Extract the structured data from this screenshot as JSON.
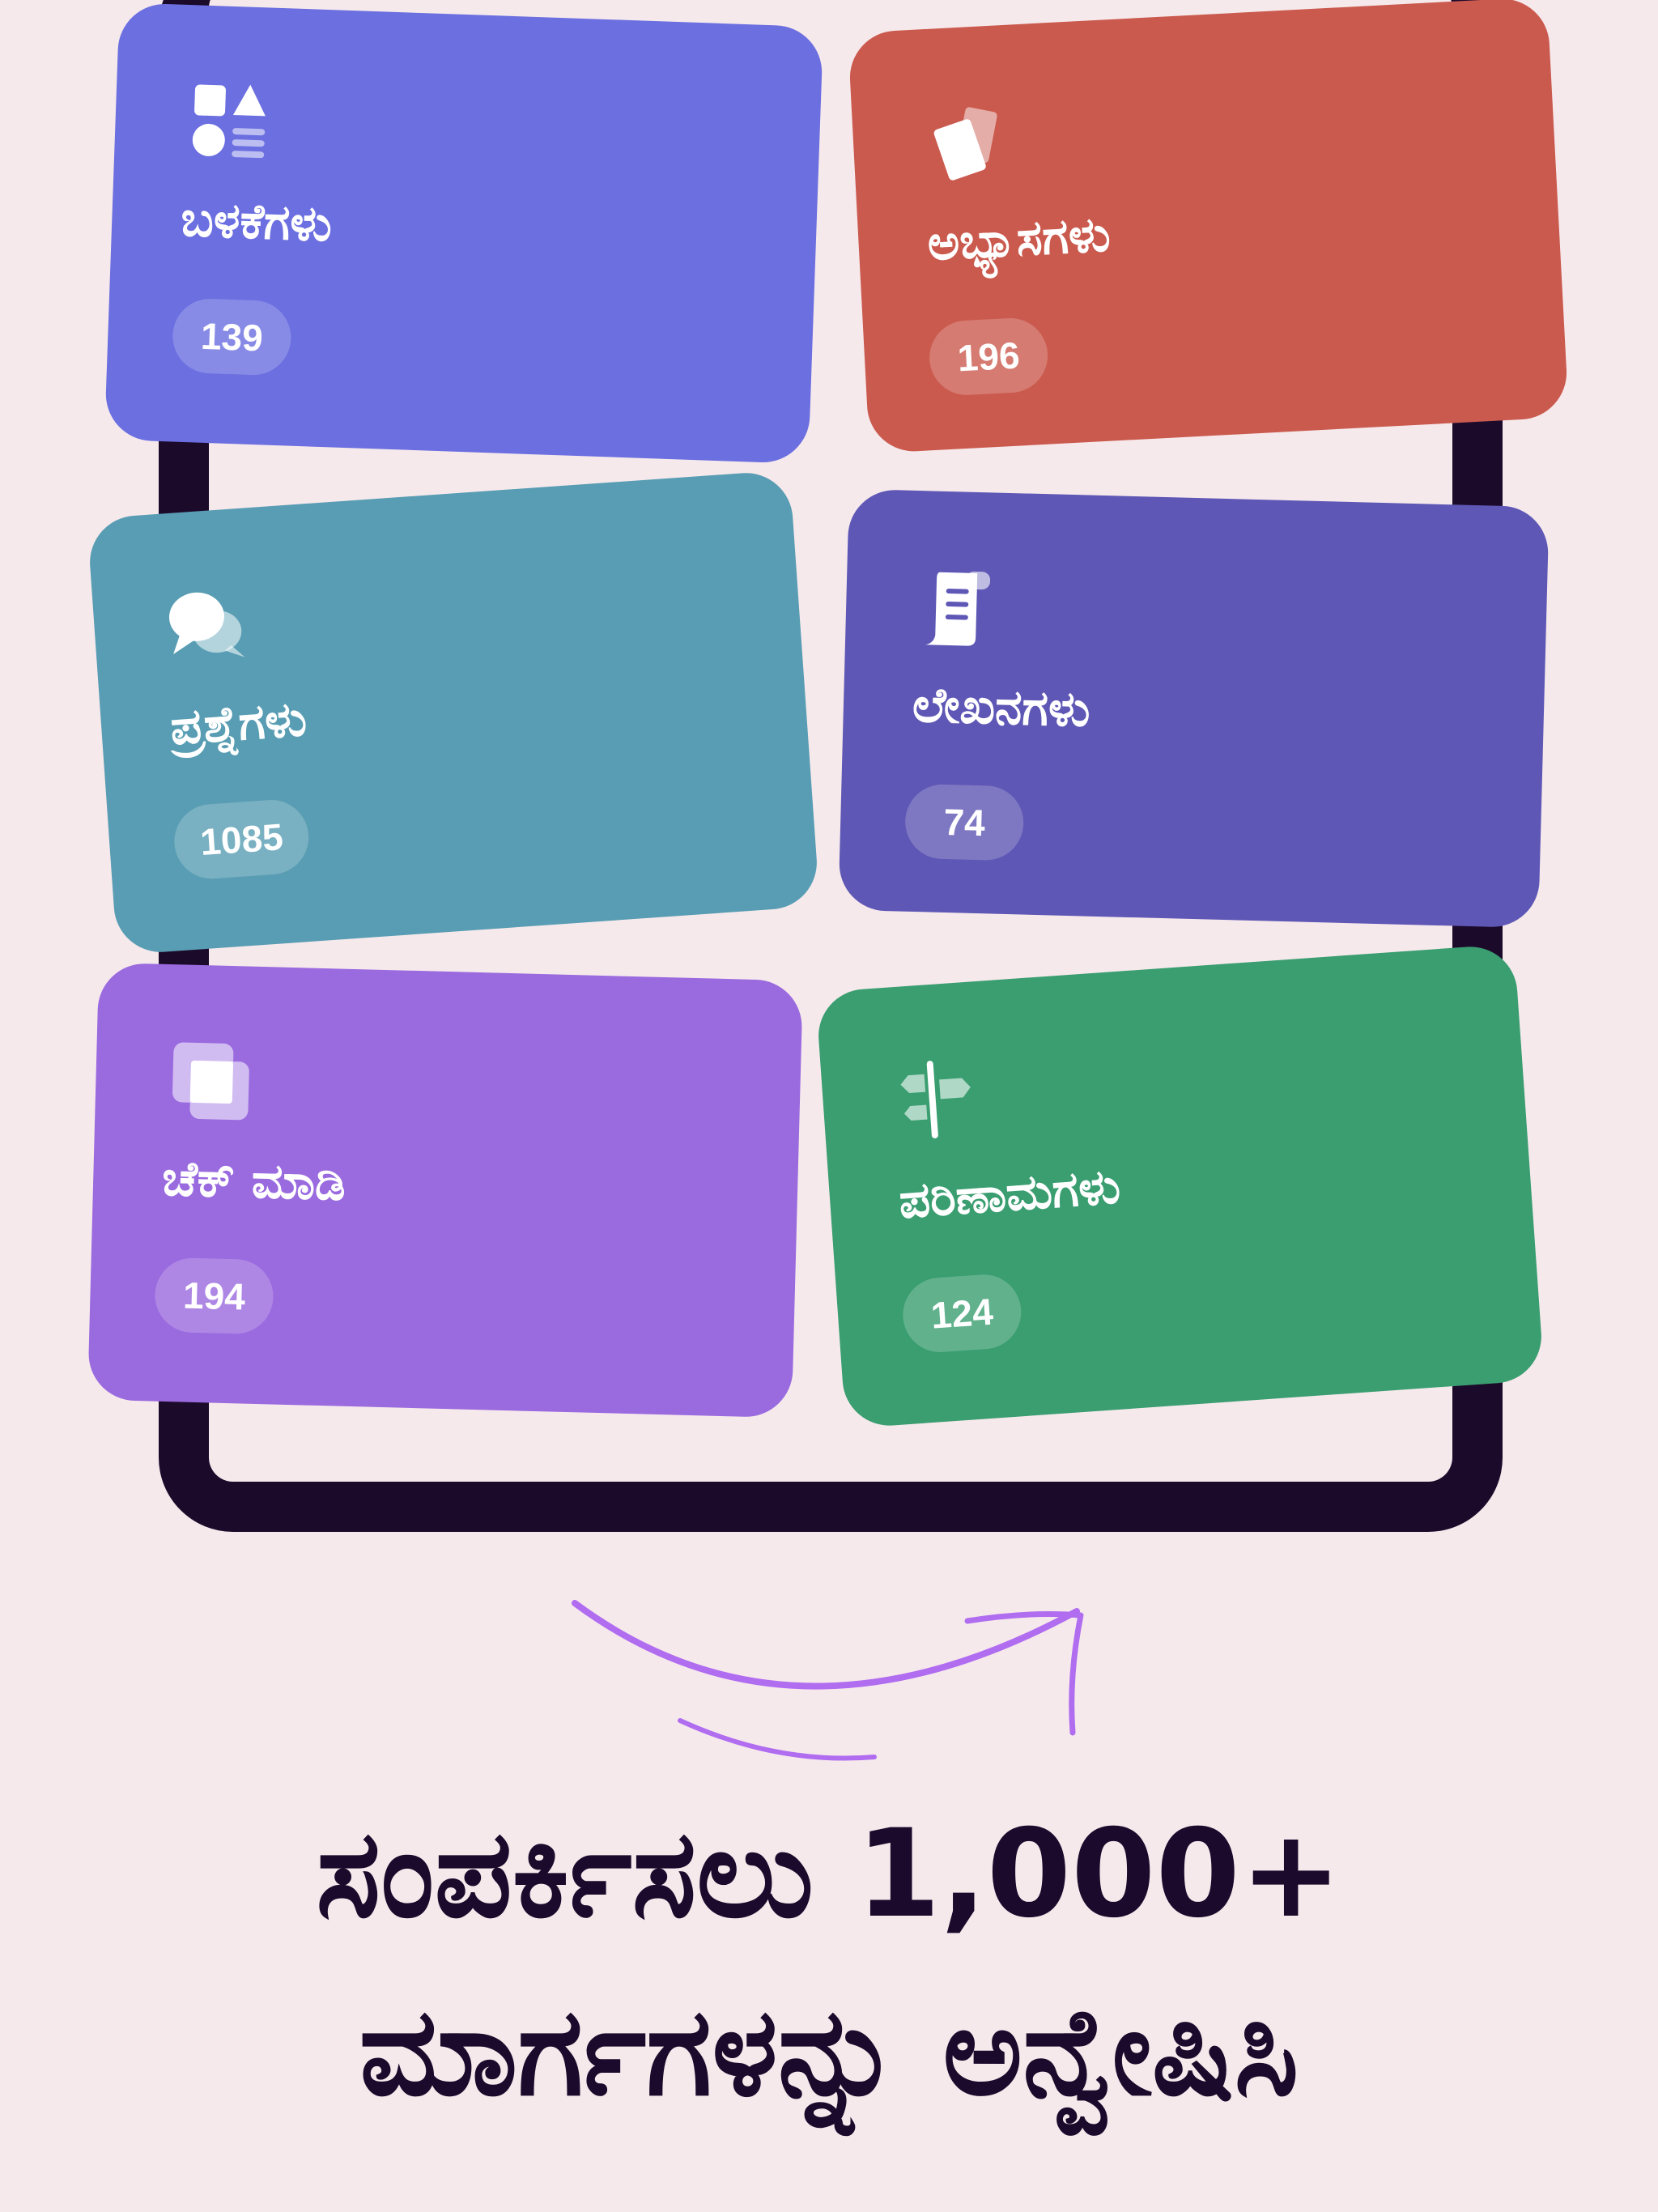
{
  "cards": [
    {
      "label": "ಬಳಕೆಗಳು",
      "count": "139",
      "icon": "shapes-icon",
      "color": "#6b6fe0"
    },
    {
      "label": "ಅಭ್ಯಾಸಗಳು",
      "count": "196",
      "icon": "cards-icon",
      "color": "#cb5a4e"
    },
    {
      "label": "ಪ್ರಶ್ನೆಗಳು",
      "count": "1085",
      "icon": "chat-bubbles-icon",
      "color": "#589db3"
    },
    {
      "label": "ಲೇಖನಗಳು",
      "count": "74",
      "icon": "scroll-icon",
      "color": "#5e57b5"
    },
    {
      "label": "ಚೆಕ್ ಮಾಡಿ",
      "count": "194",
      "icon": "check-squares-icon",
      "color": "#9a6adf"
    },
    {
      "label": "ಪರಿಣಾಮಗಳು",
      "count": "124",
      "icon": "signpost-icon",
      "color": "#3a9e71"
    }
  ],
  "headline": {
    "line1": "ಸಂಪರ್ಕಿಸಲು 1,000+",
    "line2": "ಮಾರ್ಗಗಳನ್ನು ಅನ್ವೇಷಿಸಿ"
  },
  "colors": {
    "background": "#f6e9ec",
    "device_frame": "#1c0a2b",
    "headline_text": "#1b0a2b",
    "arrow": "#b06df0"
  }
}
